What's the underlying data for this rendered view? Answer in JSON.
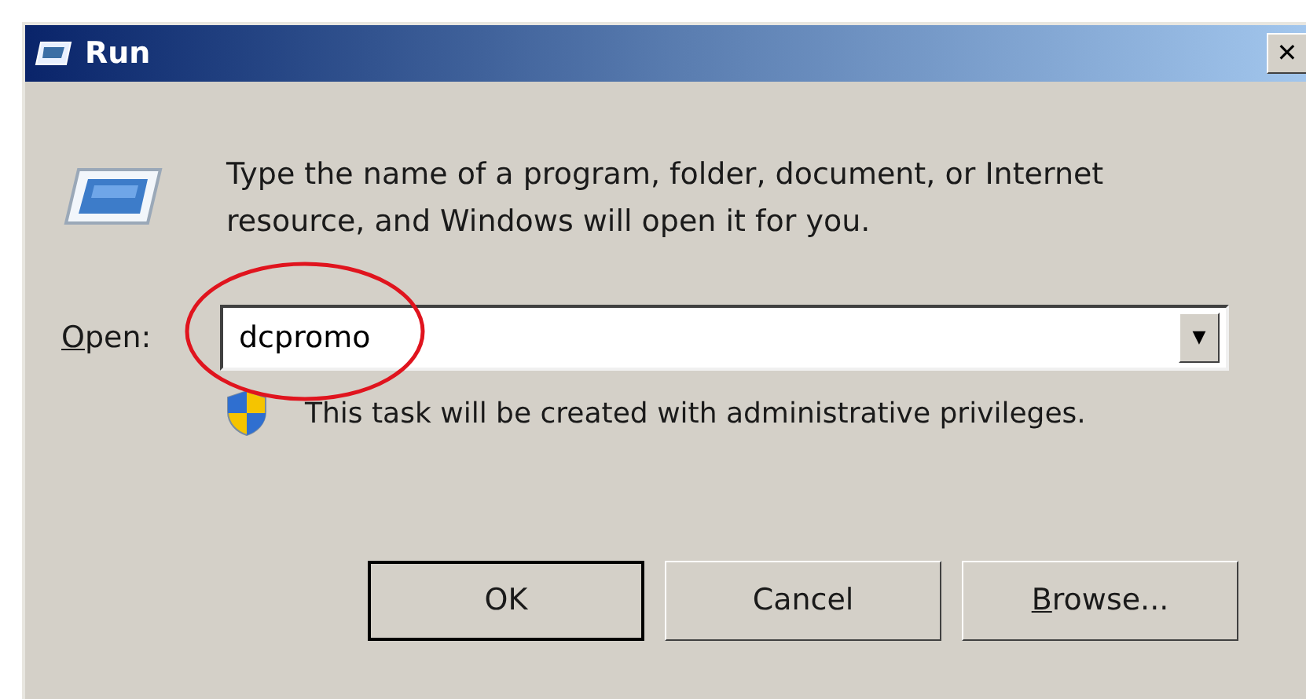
{
  "window": {
    "title": "Run",
    "close": "✕"
  },
  "description": "Type the name of a program, folder, document, or Internet resource, and Windows will open it for you.",
  "open_field": {
    "label_key": "O",
    "label_rest": "pen:",
    "value": "dcpromo",
    "dropdown": "▼",
    "highlighted": true
  },
  "notice": "This task will be created with administrative privileges.",
  "buttons": [
    {
      "label_rest": "OK",
      "default": true
    },
    {
      "label_rest": "Cancel",
      "default": false
    },
    {
      "label_key": "B",
      "label_rest": "rowse...",
      "default": false
    }
  ]
}
